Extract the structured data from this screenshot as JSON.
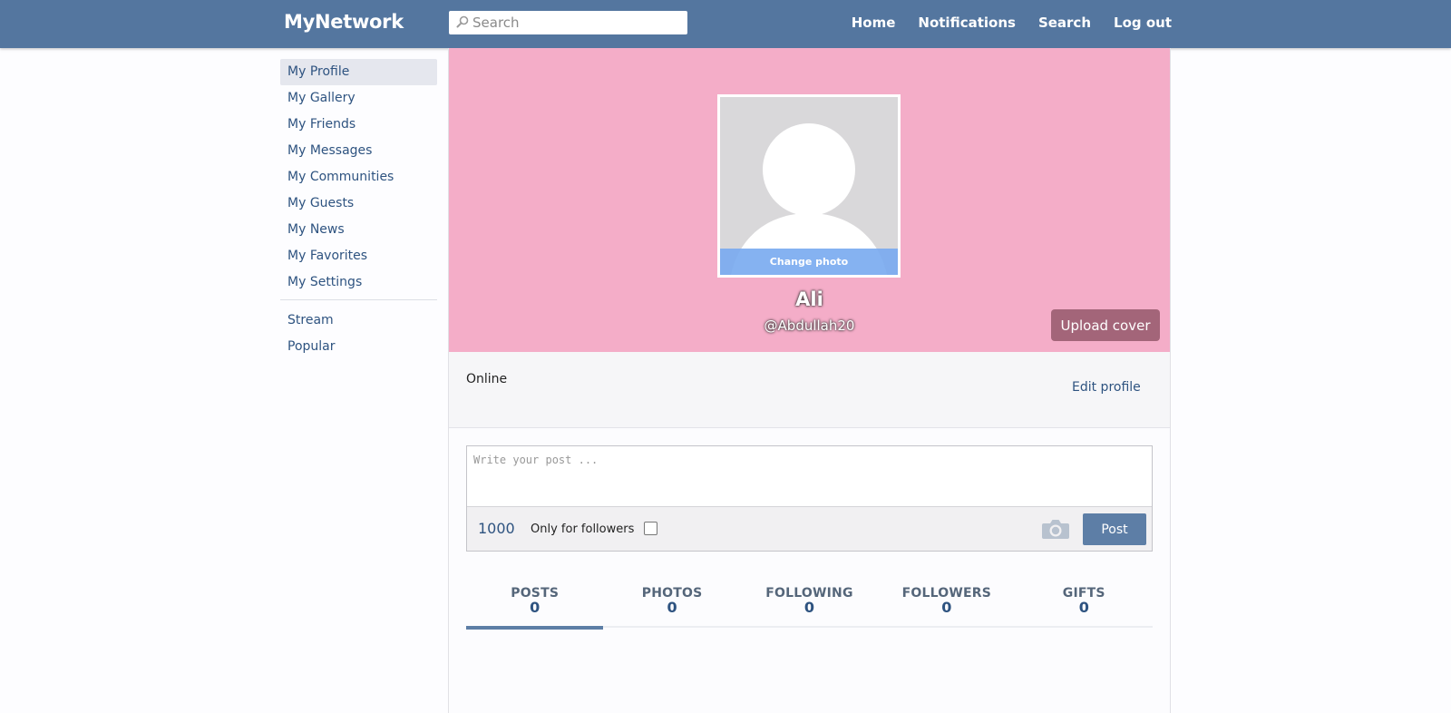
{
  "header": {
    "brand": "MyNetwork",
    "search_placeholder": "Search",
    "nav": [
      "Home",
      "Notifications",
      "Search",
      "Log out"
    ]
  },
  "sidebar": {
    "items": [
      {
        "label": "My Profile",
        "active": true
      },
      {
        "label": "My Gallery"
      },
      {
        "label": "My Friends"
      },
      {
        "label": "My Messages"
      },
      {
        "label": "My Communities"
      },
      {
        "label": "My Guests"
      },
      {
        "label": "My News"
      },
      {
        "label": "My Favorites"
      },
      {
        "label": "My Settings"
      }
    ],
    "secondary": [
      {
        "label": "Stream"
      },
      {
        "label": "Popular"
      }
    ]
  },
  "profile": {
    "change_photo": "Change photo",
    "name": "Ali",
    "handle": "@Abdullah20",
    "upload_cover": "Upload cover",
    "status": "Online",
    "edit_profile": "Edit profile",
    "cover_color": "#f4adc8"
  },
  "composer": {
    "placeholder": "Write your post ...",
    "char_count": "1000",
    "followers_label": "Only for followers",
    "post_button": "Post"
  },
  "stats": [
    {
      "label": "POSTS",
      "count": "0",
      "active": true
    },
    {
      "label": "PHOTOS",
      "count": "0"
    },
    {
      "label": "FOLLOWING",
      "count": "0"
    },
    {
      "label": "FOLLOWERS",
      "count": "0"
    },
    {
      "label": "GIFTS",
      "count": "0"
    }
  ],
  "colors": {
    "header": "#54769f",
    "accent": "#5d7ea6",
    "link": "#2e5380"
  }
}
